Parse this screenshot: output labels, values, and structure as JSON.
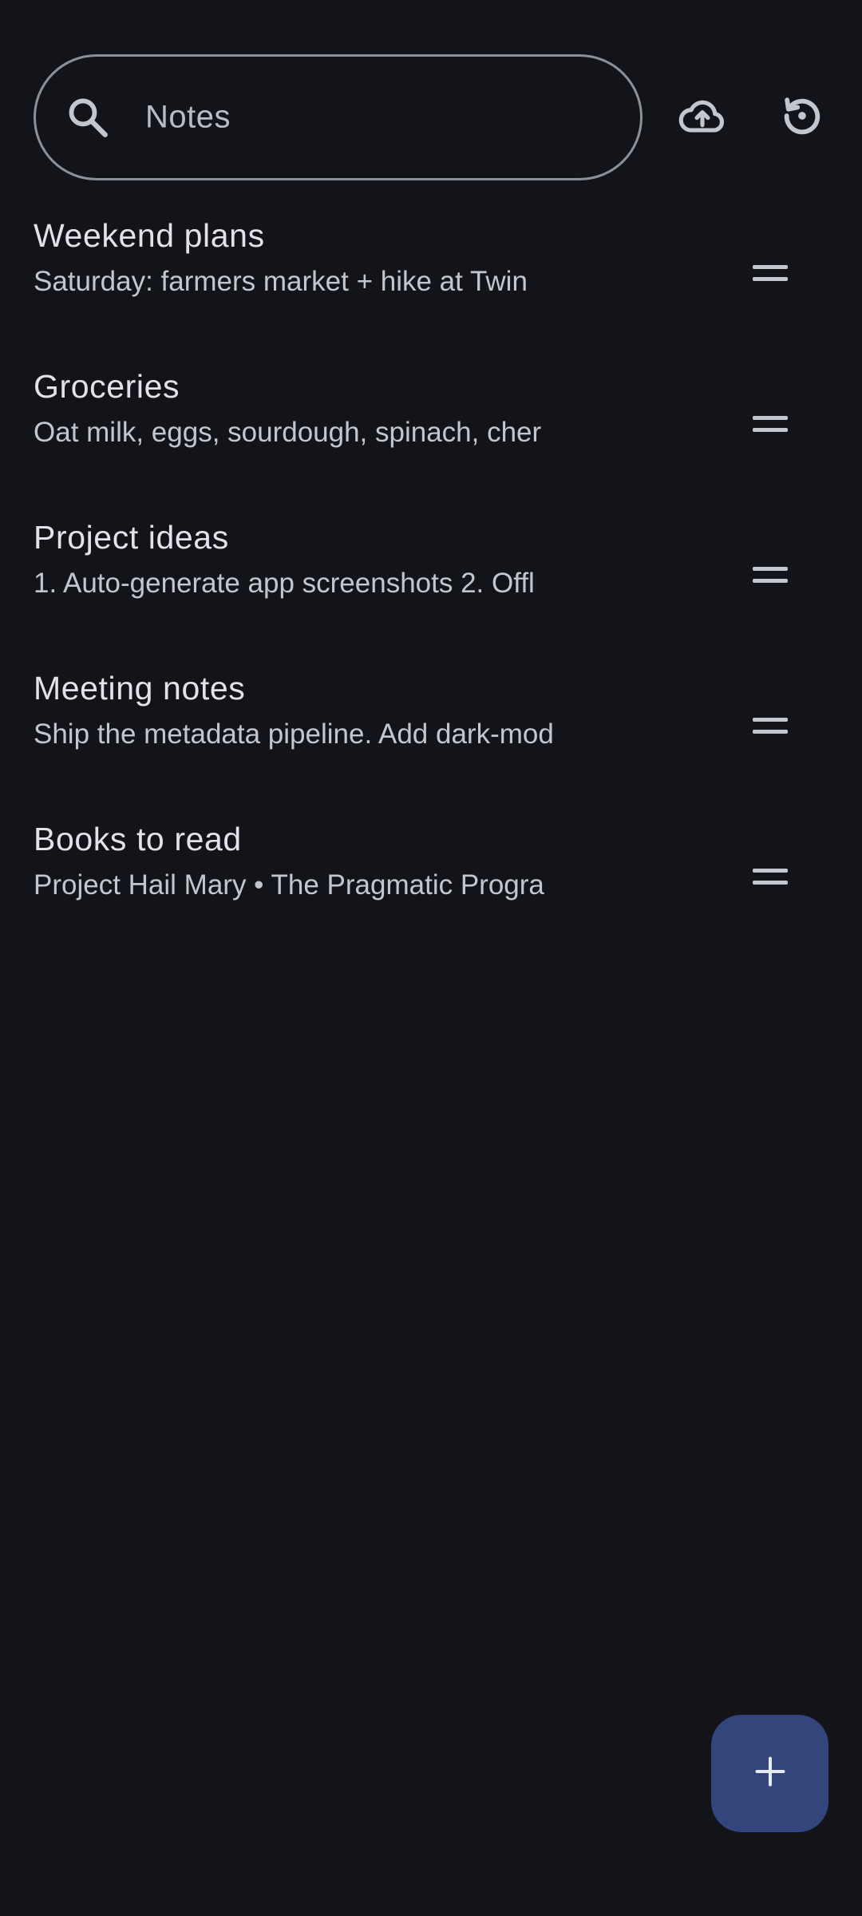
{
  "search": {
    "placeholder": "Notes",
    "icon": "search-icon"
  },
  "toolbar": {
    "sync_icon": "cloud-upload-icon",
    "restore_icon": "restore-icon"
  },
  "notes": [
    {
      "title": "Weekend plans",
      "preview": "Saturday: farmers market + hike at Twin"
    },
    {
      "title": "Groceries",
      "preview": "Oat milk, eggs, sourdough, spinach, cher"
    },
    {
      "title": "Project ideas",
      "preview": "1. Auto-generate app screenshots 2. Offl"
    },
    {
      "title": "Meeting notes",
      "preview": "Ship the metadata pipeline. Add dark-mod"
    },
    {
      "title": "Books to read",
      "preview": "Project Hail Mary • The Pragmatic Progra"
    }
  ],
  "fab": {
    "icon": "add-icon"
  },
  "colors": {
    "background": "#13141a",
    "fab": "#34457c",
    "title_text": "#e2e3ea",
    "preview_text": "#c4c6cf",
    "outline": "#8e9099"
  }
}
